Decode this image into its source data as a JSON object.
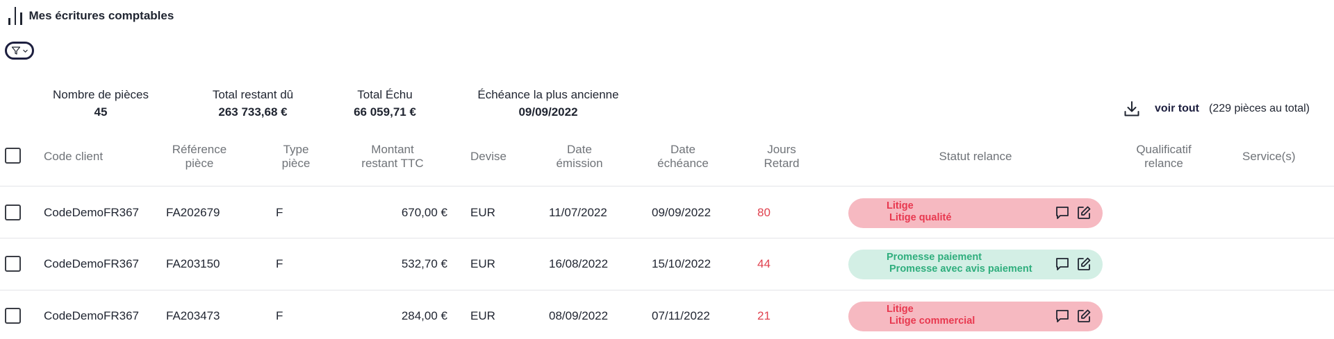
{
  "page": {
    "title": "Mes écritures comptables"
  },
  "summary": [
    {
      "label": "Nombre de pièces",
      "value": "45"
    },
    {
      "label": "Total restant dû",
      "value": "263 733,68 €"
    },
    {
      "label": "Total Échu",
      "value": "66 059,71 €"
    },
    {
      "label": "Échéance la plus ancienne",
      "value": "09/09/2022"
    }
  ],
  "export": {
    "icon": "download-icon",
    "voir_tout": "voir tout",
    "count_text": "(229 pièces au total)"
  },
  "columns": {
    "code_client": "Code client",
    "reference_1": "Référence",
    "reference_2": "pièce",
    "type_1": "Type",
    "type_2": "pièce",
    "montant_1": "Montant",
    "montant_2": "restant TTC",
    "devise": "Devise",
    "emission_1": "Date",
    "emission_2": "émission",
    "echeance_1": "Date",
    "echeance_2": "échéance",
    "jours_1": "Jours",
    "jours_2": "Retard",
    "statut": "Statut relance",
    "qualificatif_1": "Qualificatif",
    "qualificatif_2": "relance",
    "services": "Service(s)"
  },
  "rows": [
    {
      "code": "CodeDemoFR367",
      "ref": "FA202679",
      "type": "F",
      "montant": "670,00 €",
      "devise": "EUR",
      "emission": "11/07/2022",
      "echeance": "09/09/2022",
      "retard": "80",
      "statut": "Litige",
      "sous_statut": "Litige qualité",
      "statut_kind": "litige"
    },
    {
      "code": "CodeDemoFR367",
      "ref": "FA203150",
      "type": "F",
      "montant": "532,70 €",
      "devise": "EUR",
      "emission": "16/08/2022",
      "echeance": "15/10/2022",
      "retard": "44",
      "statut": "Promesse paiement",
      "sous_statut": "Promesse avec avis paiement",
      "statut_kind": "promesse"
    },
    {
      "code": "CodeDemoFR367",
      "ref": "FA203473",
      "type": "F",
      "montant": "284,00 €",
      "devise": "EUR",
      "emission": "08/09/2022",
      "echeance": "07/11/2022",
      "retard": "21",
      "statut": "Litige",
      "sous_statut": "Litige commercial",
      "statut_kind": "litige"
    }
  ],
  "colors": {
    "litige_bg": "#f6b9c1",
    "litige_text": "#e8384f",
    "promesse_bg": "#d3efe5",
    "promesse_text": "#2fae7d",
    "retard_text": "#e0424f",
    "accent": "#1d1f3f"
  }
}
